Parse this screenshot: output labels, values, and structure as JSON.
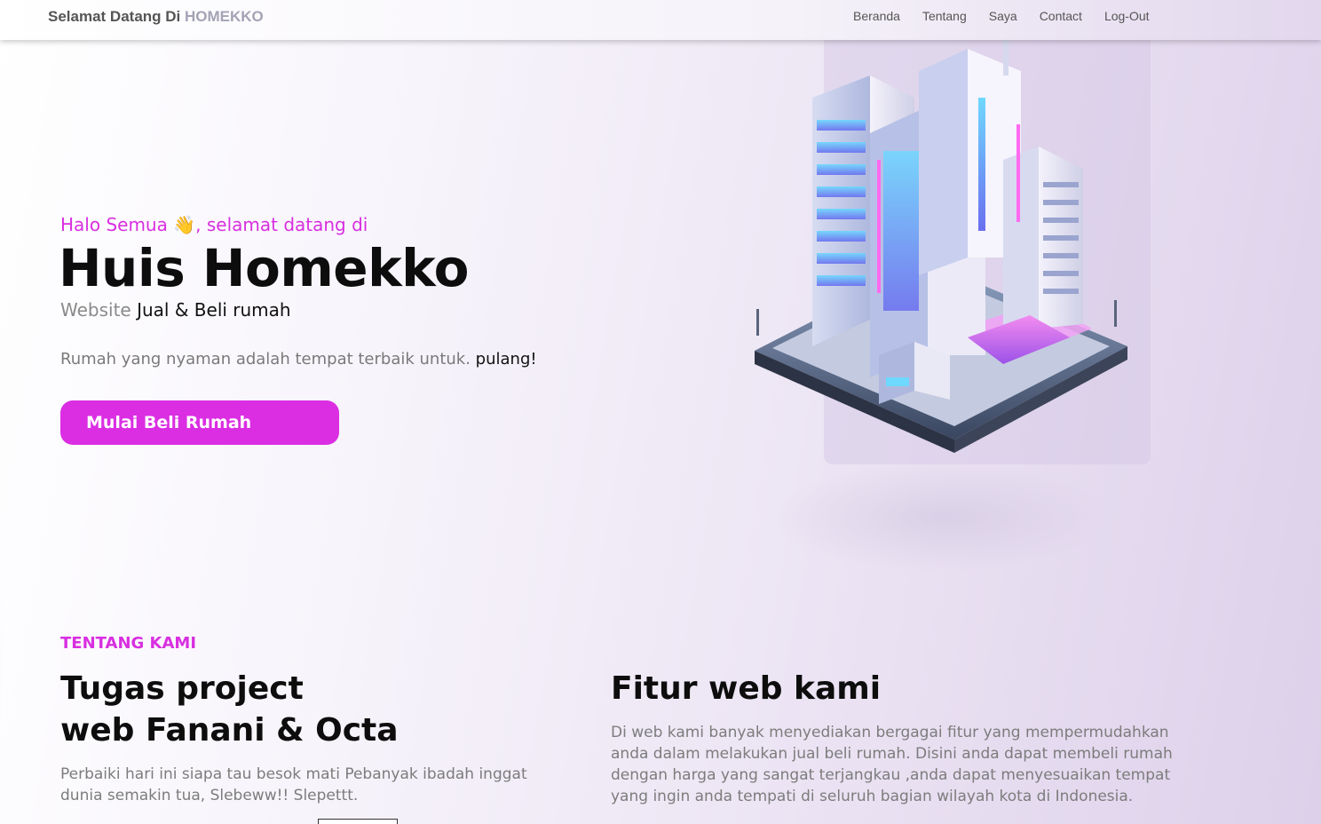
{
  "navbar": {
    "brand_prefix": "Selamat Datang Di",
    "brand_accent": "HOMEKKO",
    "links": [
      "Beranda",
      "Tentang",
      "Saya",
      "Contact",
      "Log-Out"
    ]
  },
  "hero": {
    "greeting_before": "Halo Semua ",
    "greeting_emoji": "👋",
    "greeting_after": ", selamat datang di",
    "title": "Huis Homekko",
    "subtitle_muted": "Website",
    "subtitle_rest": " Jual & Beli rumah",
    "tagline_muted": "Rumah yang nyaman adalah tempat terbaik untuk. ",
    "tagline_bold": "pulang!",
    "cta_label": "Mulai Beli Rumah"
  },
  "about": {
    "kicker": "TENTANG KAMI",
    "title_line1": "Tugas project",
    "title_line2": "web Fanani & Octa",
    "text": "Perbaiki hari ini siapa tau besok mati Pebanyak ibadah inggat dunia semakin tua, Slebeww!! Slepettt."
  },
  "features": {
    "title": "Fitur web kami",
    "text": "Di web kami banyak menyediakan bergagai fitur yang mempermudahkan anda dalam melakukan jual beli rumah. Disini anda dapat membeli rumah dengan harga yang sangat terjangkau ,anda dapat menyesuaikan tempat yang ingin anda tempati di seluruh bagian wilayah kota di Indonesia."
  },
  "colors": {
    "accent": "#db2ee3",
    "brand_accent": "#a3a3b5"
  },
  "icons": {
    "greeting": "waving-hand-icon",
    "hero_image": "isometric-building-illustration"
  }
}
